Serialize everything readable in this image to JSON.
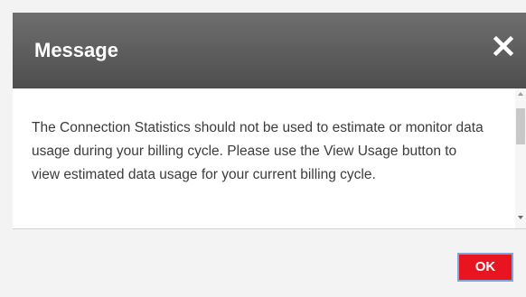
{
  "dialog": {
    "title": "Message",
    "close_icon": "close-icon",
    "message": "The Connection Statistics should not be used to estimate or monitor data usage during your billing cycle. Please use the View Usage button to view estimated data usage for your current billing cycle.",
    "ok_label": "OK"
  },
  "colors": {
    "titlebar": "#5e5e5e",
    "ok_button": "#e8141f",
    "text": "#3c3c3c"
  }
}
